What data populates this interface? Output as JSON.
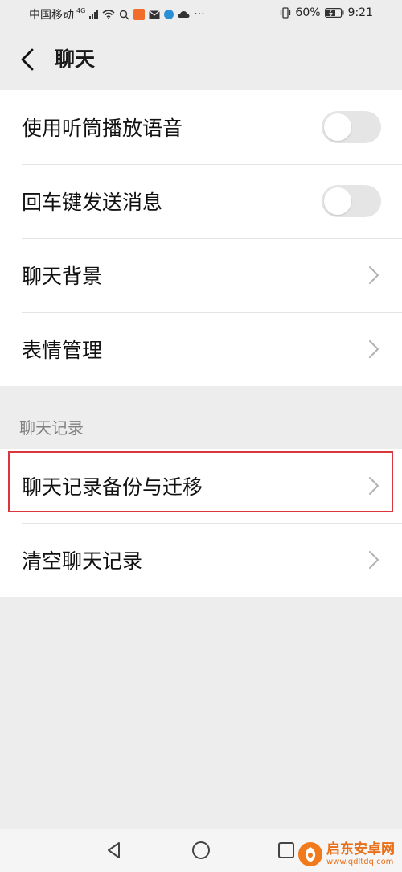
{
  "status_bar": {
    "carrier": "中国移动",
    "network": "4G",
    "battery": "60%",
    "time": "9:21",
    "more": "···"
  },
  "header": {
    "title": "聊天"
  },
  "settings": [
    {
      "label": "使用听筒播放语音",
      "control": "toggle",
      "on": false
    },
    {
      "label": "回车键发送消息",
      "control": "toggle",
      "on": false
    },
    {
      "label": "聊天背景",
      "control": "chevron"
    },
    {
      "label": "表情管理",
      "control": "chevron"
    }
  ],
  "history_section": {
    "title": "聊天记录",
    "items": [
      {
        "label": "聊天记录备份与迁移",
        "control": "chevron",
        "highlighted": true
      },
      {
        "label": "清空聊天记录",
        "control": "chevron"
      }
    ]
  },
  "watermark": {
    "name": "启东安卓网",
    "url": "www.qdltdq.com"
  },
  "colors": {
    "background": "#ededed",
    "surface": "#ffffff",
    "highlight": "#d9363e",
    "toggle_off": "#e5e5e5",
    "watermark": "#e8701a"
  }
}
